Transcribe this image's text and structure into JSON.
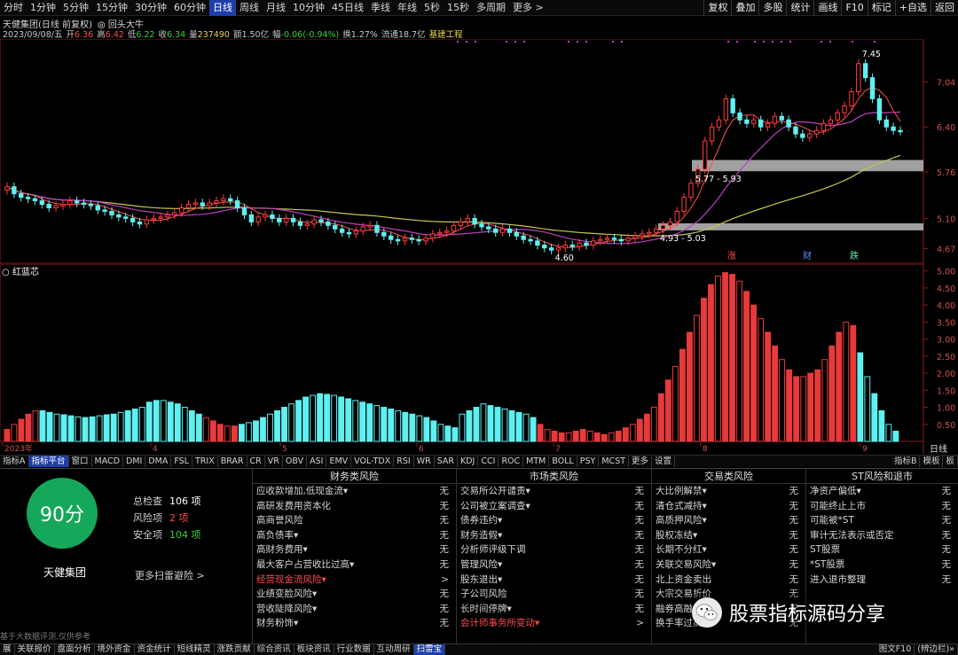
{
  "toolbar": {
    "timeframes": [
      "分时",
      "1分钟",
      "5分钟",
      "15分钟",
      "30分钟",
      "60分钟",
      "日线",
      "周线",
      "月线",
      "10分钟",
      "45日线",
      "季线",
      "年线",
      "5秒",
      "15秒",
      "多周期",
      "更多 >"
    ],
    "active_timeframe": "日线",
    "right_buttons": [
      "复权",
      "叠加",
      "多股",
      "统计",
      "画线",
      "F10",
      "标记",
      "+自选",
      "返回"
    ]
  },
  "info": {
    "title": "天健集团(日线 前复权)",
    "indicator_name": "回头大牛",
    "date": "2023/09/08/五",
    "open_label": "开",
    "open": "6.36",
    "high_label": "高",
    "high": "6.42",
    "low_label": "低",
    "low": "6.22",
    "close_label": "收",
    "close": "6.34",
    "volume_label": "量",
    "volume": "237490",
    "amount_label": "额",
    "amount": "1.50亿",
    "change_label": "幅",
    "change": "-0.06(-0.94%)",
    "turnover_label": "换",
    "turnover": "1.27%",
    "float_label": "流通",
    "float": "18.7亿",
    "sector": "基建工程"
  },
  "main_chart": {
    "price_ticks": [
      "7.04",
      "6.40",
      "5.76",
      "5.10",
      "4.67"
    ],
    "annotations": {
      "max": "7.45",
      "min": "4.60",
      "box1": "5.77 - 5.93",
      "box2": "4.93 - 5.03"
    },
    "event_marks": [
      "涨",
      "财",
      "跌"
    ],
    "month_marks": [
      "6"
    ]
  },
  "indicator": {
    "name": "红蓝芯",
    "ticks": [
      "5.00",
      "4.50",
      "4.00",
      "3.50",
      "3.00",
      "2.50",
      "2.00",
      "1.50",
      "1.00",
      "0.50"
    ],
    "x_labels": [
      "2023年",
      "4",
      "5",
      "6",
      "7",
      "8",
      "9"
    ],
    "right_label": "日线"
  },
  "chart_data": {
    "type": "bar",
    "title": "红蓝芯",
    "ylim": [
      0,
      5.2
    ],
    "series": [
      {
        "values": [
          0.35,
          0.5,
          0.65,
          0.8,
          0.9,
          0.9,
          0.85,
          0.8,
          0.78,
          0.75,
          0.72,
          0.7,
          0.72,
          0.75,
          0.78,
          0.8,
          0.85,
          0.9,
          0.95,
          1.0,
          1.15,
          1.2,
          1.2,
          1.15,
          1.1,
          1.0,
          0.9,
          0.8,
          0.7,
          0.6,
          0.5,
          0.45,
          0.45,
          0.5,
          0.55,
          0.6,
          0.7,
          0.8,
          0.9,
          1.0,
          1.1,
          1.2,
          1.3,
          1.35,
          1.4,
          1.38,
          1.35,
          1.3,
          1.25,
          1.2,
          1.15,
          1.1,
          1.05,
          1.0,
          0.95,
          0.9,
          0.85,
          0.8,
          0.75,
          0.7,
          0.6,
          0.5,
          0.45,
          0.4,
          0.8,
          0.9,
          1.0,
          1.1,
          1.05,
          1.0,
          0.95,
          0.9,
          0.85,
          0.8,
          0.7,
          0.5,
          0.35,
          0.3,
          0.25,
          0.25,
          0.3,
          0.35,
          0.3,
          0.25,
          0.2,
          0.25,
          0.3,
          0.4,
          0.5,
          0.65,
          0.8,
          1.0,
          1.4,
          1.8,
          2.2,
          2.7,
          3.2,
          3.7,
          4.2,
          4.6,
          4.85,
          4.95,
          4.9,
          4.7,
          4.4,
          4.0,
          3.6,
          3.2,
          2.8,
          2.4,
          2.1,
          1.9,
          1.9,
          2.0,
          2.1,
          2.4,
          2.8,
          3.2,
          3.5,
          3.4,
          2.6,
          1.9,
          1.4,
          0.9,
          0.5,
          0.3
        ],
        "colors": [
          "r",
          "r",
          "r",
          "r",
          "r",
          "c",
          "c",
          "c",
          "c",
          "c",
          "c",
          "c",
          "c",
          "c",
          "c",
          "c",
          "c",
          "c",
          "c",
          "c",
          "c",
          "c",
          "c",
          "c",
          "c",
          "c",
          "c",
          "c",
          "r",
          "r",
          "r",
          "r",
          "r",
          "c",
          "c",
          "c",
          "c",
          "c",
          "c",
          "c",
          "c",
          "c",
          "c",
          "c",
          "c",
          "c",
          "c",
          "c",
          "c",
          "c",
          "c",
          "c",
          "c",
          "c",
          "c",
          "c",
          "c",
          "c",
          "c",
          "c",
          "c",
          "c",
          "c",
          "c",
          "c",
          "c",
          "c",
          "c",
          "c",
          "c",
          "c",
          "c",
          "c",
          "c",
          "c",
          "r",
          "r",
          "r",
          "r",
          "r",
          "r",
          "r",
          "r",
          "r",
          "r",
          "r",
          "r",
          "r",
          "r",
          "r",
          "r",
          "r",
          "r",
          "r",
          "r",
          "r",
          "r",
          "r",
          "r",
          "r",
          "r",
          "r",
          "r",
          "r",
          "r",
          "r",
          "r",
          "r",
          "r",
          "r",
          "r",
          "r",
          "r",
          "r",
          "r",
          "r",
          "r",
          "r",
          "r",
          "r",
          "c",
          "c",
          "c",
          "c",
          "c",
          "c"
        ]
      }
    ]
  },
  "tabs": {
    "items": [
      "指标A",
      "指标平台",
      "窗口",
      "MACD",
      "DMI",
      "DMA",
      "FSL",
      "TRIX",
      "BRAR",
      "CR",
      "VR",
      "OBV",
      "ASI",
      "EMV",
      "VOL-TDX",
      "RSI",
      "WR",
      "SAR",
      "KDJ",
      "CCI",
      "ROC",
      "MTM",
      "BOLL",
      "PSY",
      "MCST",
      "更多",
      "设置"
    ],
    "active": "指标平台",
    "right": [
      "指标B",
      "模板",
      "板"
    ]
  },
  "risk": {
    "score": "90分",
    "company": "天健集团",
    "total_label": "总检查",
    "total": "106 项",
    "risk_label": "风险项",
    "risk": "2 项",
    "safe_label": "安全项",
    "safe": "104 项",
    "more": "更多扫雷避险 >",
    "disclaimer": "基于大数据评测,仅供参考",
    "columns": [
      {
        "title": "财务类风险",
        "rows": [
          {
            "label": "应收款增加,低现金流▾",
            "status": "无"
          },
          {
            "label": "高研发费用资本化",
            "status": "无"
          },
          {
            "label": "高商誉风险",
            "status": "无"
          },
          {
            "label": "高负债率▾",
            "status": "无"
          },
          {
            "label": "高财务费用▾",
            "status": "无"
          },
          {
            "label": "最大客户占营收比过高▾",
            "status": "无"
          },
          {
            "label": "经营现金流风险▾",
            "status": ">",
            "warn": true
          },
          {
            "label": "业绩变脸风险▾",
            "status": "无"
          },
          {
            "label": "营收陡降风险▾",
            "status": "无"
          },
          {
            "label": "财务粉饰▾",
            "status": "无"
          }
        ]
      },
      {
        "title": "市场类风险",
        "rows": [
          {
            "label": "交易所公开谴责▾",
            "status": "无"
          },
          {
            "label": "公司被立案调查▾",
            "status": "无"
          },
          {
            "label": "债券违约▾",
            "status": "无"
          },
          {
            "label": "财务造假▾",
            "status": "无"
          },
          {
            "label": "分析师评级下调",
            "status": "无"
          },
          {
            "label": "管理风险▾",
            "status": "无"
          },
          {
            "label": "股东退出▾",
            "status": "无"
          },
          {
            "label": "子公司风险",
            "status": "无"
          },
          {
            "label": "长时间停牌▾",
            "status": "无"
          },
          {
            "label": "会计师事务所变动▾",
            "status": ">",
            "warn": true
          }
        ]
      },
      {
        "title": "交易类风险",
        "rows": [
          {
            "label": "大比例解禁▾",
            "status": "无"
          },
          {
            "label": "清仓式减持▾",
            "status": "无"
          },
          {
            "label": "高质押风险▾",
            "status": "无"
          },
          {
            "label": "股权冻结▾",
            "status": "无"
          },
          {
            "label": "长期不分红▾",
            "status": "无"
          },
          {
            "label": "关联交易风险▾",
            "status": "无"
          },
          {
            "label": "北上资金卖出",
            "status": "无"
          },
          {
            "label": "大宗交易折价",
            "status": "无"
          },
          {
            "label": "融券高融券",
            "status": "无"
          },
          {
            "label": "换手率过高▾",
            "status": "无"
          }
        ]
      },
      {
        "title": "ST风险和退市",
        "rows": [
          {
            "label": "净资产偏低▾",
            "status": "无"
          },
          {
            "label": "可能终止上市",
            "status": "无"
          },
          {
            "label": "可能被*ST",
            "status": "无"
          },
          {
            "label": "审计无法表示或否定",
            "status": "无"
          },
          {
            "label": "ST股票",
            "status": "无"
          },
          {
            "label": "*ST股票",
            "status": "无"
          },
          {
            "label": "进入退市整理",
            "status": "无"
          }
        ]
      }
    ],
    "watermark": "股票指标源码分享"
  },
  "bottom_tabs": {
    "items": [
      "展",
      "关联报价",
      "盘面分析",
      "境外资金",
      "资金统计",
      "短线精灵",
      "涨跌贡献",
      "综合资讯",
      "板块资讯",
      "行业数据",
      "互动周研",
      "扫雷宝"
    ],
    "active": "扫雷宝",
    "right": [
      "图文F10",
      "(辨边栏)»"
    ]
  },
  "colors": {
    "accent": "#1e3ea8",
    "up": "#ff4a4a",
    "down": "#5ff0f0",
    "score": "#15a85a"
  }
}
